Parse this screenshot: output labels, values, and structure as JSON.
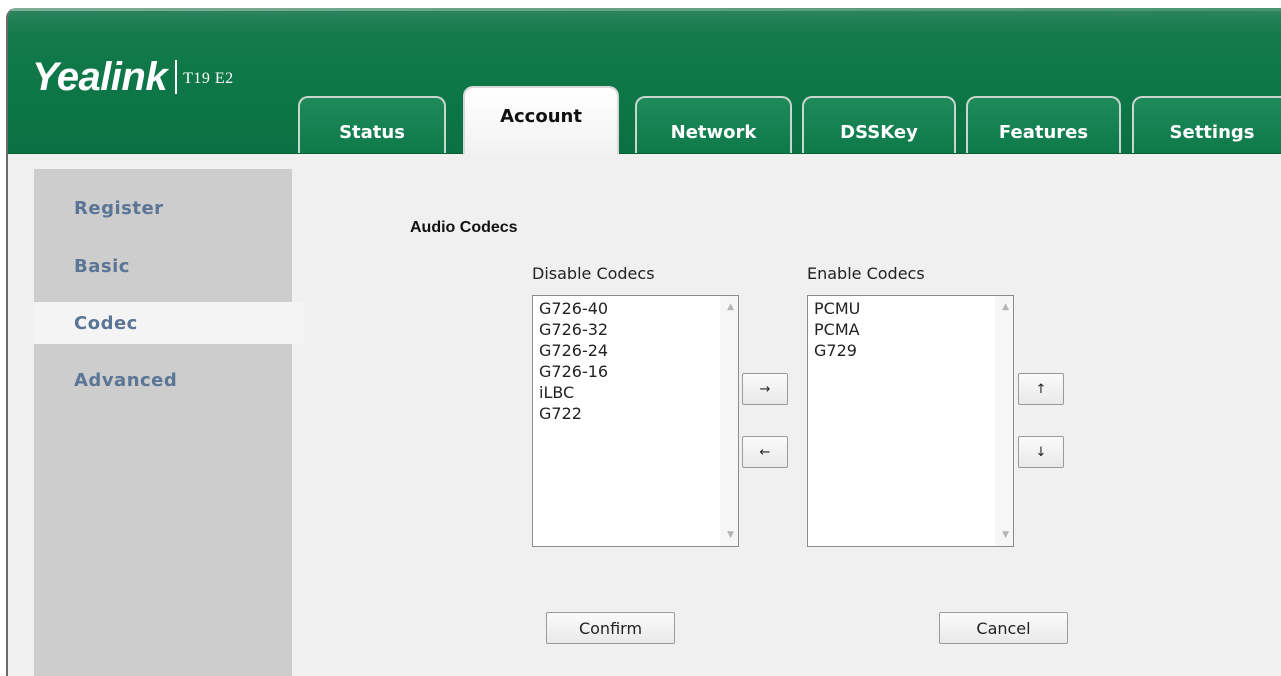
{
  "brand": {
    "name": "Yealink",
    "model": "T19 E2"
  },
  "tabs": [
    {
      "label": "Status"
    },
    {
      "label": "Account"
    },
    {
      "label": "Network"
    },
    {
      "label": "DSSKey"
    },
    {
      "label": "Features"
    },
    {
      "label": "Settings"
    }
  ],
  "active_tab": "Account",
  "sidebar": {
    "items": [
      {
        "label": "Register"
      },
      {
        "label": "Basic"
      },
      {
        "label": "Codec"
      },
      {
        "label": "Advanced"
      }
    ],
    "active": "Codec"
  },
  "main": {
    "section_title": "Audio Codecs",
    "disable_label": "Disable Codecs",
    "enable_label": "Enable Codecs",
    "disabled_codecs": [
      "G726-40",
      "G726-32",
      "G726-24",
      "G726-16",
      "iLBC",
      "G722"
    ],
    "enabled_codecs": [
      "PCMU",
      "PCMA",
      "G729"
    ],
    "move_right_label": "→",
    "move_left_label": "←",
    "move_up_label": "↑",
    "move_down_label": "↓",
    "confirm_label": "Confirm",
    "cancel_label": "Cancel"
  },
  "colors": {
    "header_green": "#0d7646",
    "sidebar_bg": "#cdcdcd",
    "sidebar_text": "#5a7595",
    "content_bg": "#f0f0f0"
  }
}
